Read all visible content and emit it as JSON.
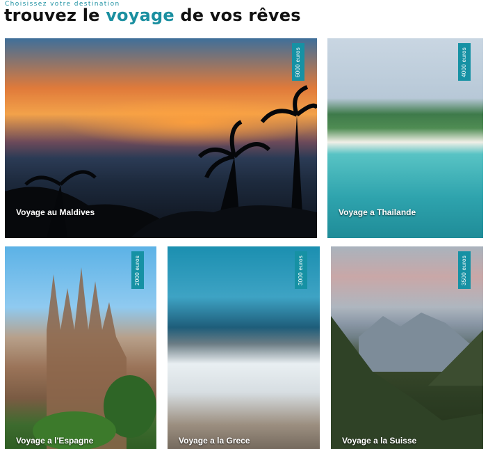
{
  "header": {
    "subtitle": "Choisissez votre destination",
    "title_before": "trouvez le ",
    "title_accent": "voyage",
    "title_after": " de vos rêves",
    "accent_color": "#1a8fa0"
  },
  "cards": {
    "maldives": {
      "caption": "Voyage au Maldives",
      "price": "6000 euros"
    },
    "thailande": {
      "caption": "Voyage a Thailande",
      "price": "4000 euros"
    },
    "espagne": {
      "caption": "Voyage a l'Espagne",
      "price": "2000 euros"
    },
    "grece": {
      "caption": "Voyage a la Grece",
      "price": "3000 euros"
    },
    "suisse": {
      "caption": "Voyage a la Suisse",
      "price": "3500 euros"
    }
  },
  "badge_color": "#1691a4"
}
